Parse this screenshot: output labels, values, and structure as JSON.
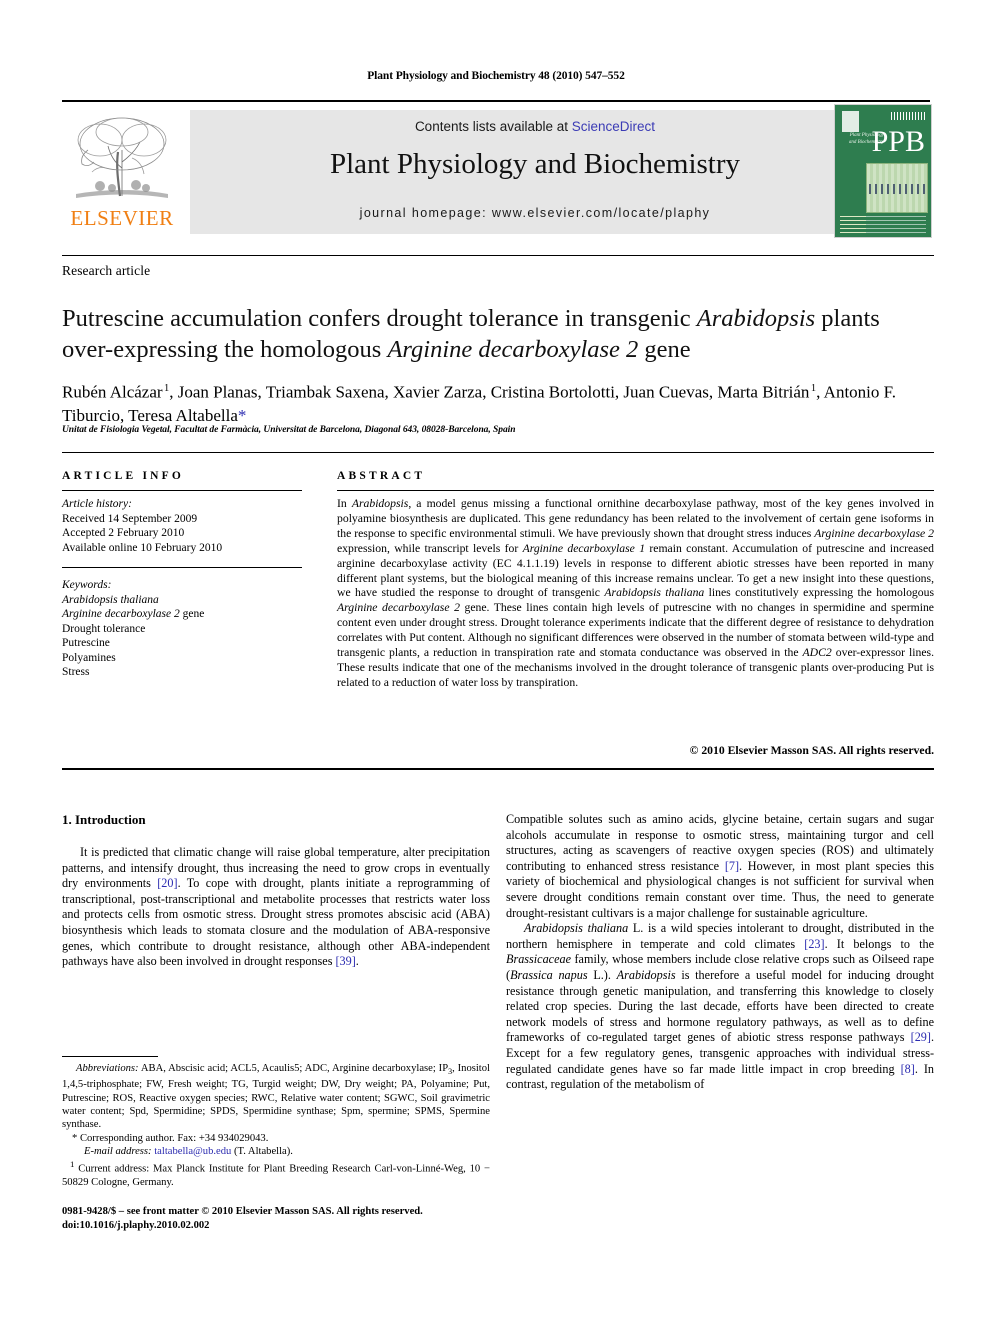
{
  "running_head": "Plant Physiology and Biochemistry 48 (2010) 547–552",
  "masthead": {
    "contents_prefix": "Contents lists available at ",
    "sciencedirect": "ScienceDirect",
    "journal_title": "Plant Physiology and Biochemistry",
    "homepage": "journal homepage: www.elsevier.com/locate/plaphy",
    "publisher": "ELSEVIER",
    "cover_abbrev": "PPB",
    "cover_journal_title": "Plant Physiology and Biochemistry",
    "accent_link_color": "#3b3bb5",
    "publisher_color": "#F07F13",
    "cover_color": "#2e7d4f",
    "banner_background": "#e6e6e6"
  },
  "article": {
    "type": "Research article",
    "title_part1": "Putrescine accumulation confers drought tolerance in transgenic ",
    "title_italic1": "Arabidopsis",
    "title_part2": " plants over-expressing the homologous ",
    "title_italic2": "Arginine decarboxylase 2",
    "title_part3": " gene",
    "authors": "Rubén Alcázar 1, Joan Planas, Triambak Saxena, Xavier Zarza, Cristina Bortolotti, Juan Cuevas, Marta Bitrián 1, Antonio F. Tiburcio, Teresa Altabella*",
    "affiliation": "Unitat de Fisiologia Vegetal, Facultat de Farmàcia, Universitat de Barcelona, Diagonal 643, 08028-Barcelona, Spain"
  },
  "article_info": {
    "heading": "ARTICLE INFO",
    "history_label": "Article history:",
    "history": [
      "Received 14 September 2009",
      "Accepted 2 February 2010",
      "Available online 10 February 2010"
    ],
    "keywords_label": "Keywords:",
    "keywords": [
      "Arabidopsis thaliana",
      "Arginine decarboxylase 2 gene",
      "Drought tolerance",
      "Putrescine",
      "Polyamines",
      "Stress"
    ]
  },
  "abstract": {
    "heading": "ABSTRACT",
    "text": "In Arabidopsis, a model genus missing a functional ornithine decarboxylase pathway, most of the key genes involved in polyamine biosynthesis are duplicated. This gene redundancy has been related to the involvement of certain gene isoforms in the response to specific environmental stimuli. We have previously shown that drought stress induces Arginine decarboxylase 2 expression, while transcript levels for Arginine decarboxylase 1 remain constant. Accumulation of putrescine and increased arginine decarboxylase activity (EC 4.1.1.19) levels in response to different abiotic stresses have been reported in many different plant systems, but the biological meaning of this increase remains unclear. To get a new insight into these questions, we have studied the response to drought of transgenic Arabidopsis thaliana lines constitutively expressing the homologous Arginine decarboxylase 2 gene. These lines contain high levels of putrescine with no changes in spermidine and spermine content even under drought stress. Drought tolerance experiments indicate that the different degree of resistance to dehydration correlates with Put content. Although no significant differences were observed in the number of stomata between wild-type and transgenic plants, a reduction in transpiration rate and stomata conductance was observed in the ADC2 over-expressor lines. These results indicate that one of the mechanisms involved in the drought tolerance of transgenic plants over-producing Put is related to a reduction of water loss by transpiration.",
    "copyright": "© 2010 Elsevier Masson SAS. All rights reserved."
  },
  "body": {
    "section_number_title": "1. Introduction",
    "left_paragraph": "It is predicted that climatic change will raise global temperature, alter precipitation patterns, and intensify drought, thus increasing the need to grow crops in eventually dry environments [20]. To cope with drought, plants initiate a reprogramming of transcriptional, post-transcriptional and metabolite processes that restricts water loss and protects cells from osmotic stress. Drought stress promotes abscisic acid (ABA) biosynthesis which leads to stomata closure and the modulation of ABA-responsive genes, which contribute to drought resistance, although other ABA-independent pathways have also been involved in drought responses [39].",
    "right_paragraph_1": "Compatible solutes such as amino acids, glycine betaine, certain sugars and sugar alcohols accumulate in response to osmotic stress, maintaining turgor and cell structures, acting as scavengers of reactive oxygen species (ROS) and ultimately contributing to enhanced stress resistance [7]. However, in most plant species this variety of biochemical and physiological changes is not sufficient for survival when severe drought conditions remain constant over time. Thus, the need to generate drought-resistant cultivars is a major challenge for sustainable agriculture.",
    "right_paragraph_2": "Arabidopsis thaliana L. is a wild species intolerant to drought, distributed in the northern hemisphere in temperate and cold climates [23]. It belongs to the Brassicaceae family, whose members include close relative crops such as Oilseed rape (Brassica napus L.). Arabidopsis is therefore a useful model for inducing drought resistance through genetic manipulation, and transferring this knowledge to closely related crop species. During the last decade, efforts have been directed to create network models of stress and hormone regulatory pathways, as well as to define frameworks of co-regulated target genes of abiotic stress response pathways [29]. Except for a few regulatory genes, transgenic approaches with individual stress-regulated candidate genes have so far made little impact in crop breeding [8]. In contrast, regulation of the metabolism of"
  },
  "footnotes": {
    "abbreviations_label": "Abbreviations:",
    "abbreviations": "ABA, Abscisic acid; ACL5, Acaulis5; ADC, Arginine decarboxylase; IP3, Inositol 1,4,5-triphosphate; FW, Fresh weight; TG, Turgid weight; DW, Dry weight; PA, Polyamine; Put, Putrescine; ROS, Reactive oxygen species; RWC, Relative water content; SGWC, Soil gravimetric water content; Spd, Spermidine; SPDS, Spermidine synthase; Spm, spermine; SPMS, Spermine synthase.",
    "corresponding": "* Corresponding author. Fax: +34 934029043.",
    "email_label": "E-mail address:",
    "email": "taltabella@ub.edu",
    "email_suffix": " (T. Altabella).",
    "current_address_marker": "1",
    "current_address": "Current address: Max Planck Institute for Plant Breeding Research Carl-von-Linné-Weg, 10 − 50829 Cologne, Germany."
  },
  "imprint": {
    "line1": "0981-9428/$ – see front matter © 2010 Elsevier Masson SAS. All rights reserved.",
    "line2": "doi:10.1016/j.plaphy.2010.02.002"
  }
}
